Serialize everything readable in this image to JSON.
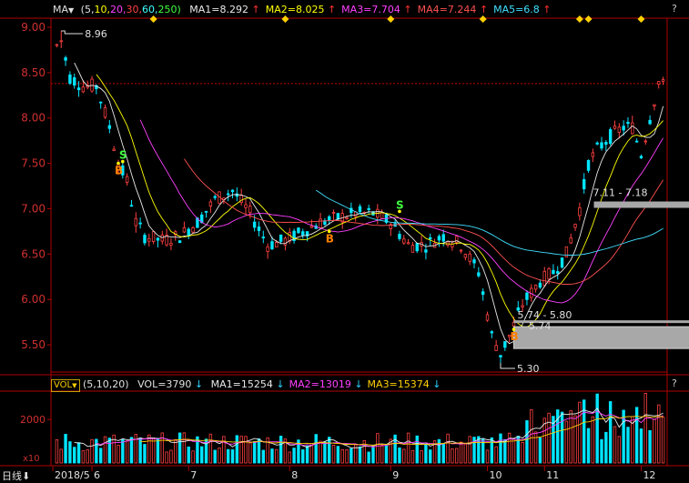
{
  "main_legend": {
    "indicator": "MA",
    "params": "(5,10,20,30,60,250)",
    "params_parts": [
      {
        "text": "(5,",
        "color": "#e0e0e0"
      },
      {
        "text": "10,",
        "color": "#ffff00"
      },
      {
        "text": "20,",
        "color": "#ff40ff"
      },
      {
        "text": "30,",
        "color": "#ff4040"
      },
      {
        "text": "60,",
        "color": "#40ffff"
      },
      {
        "text": "250)",
        "color": "#40ff40"
      }
    ],
    "items": [
      {
        "label": "MA1=8.292",
        "arrow": "↑",
        "color": "#e8e8e8"
      },
      {
        "label": "MA2=8.025",
        "arrow": "↑",
        "color": "#ffff00"
      },
      {
        "label": "MA3=7.704",
        "arrow": "↑",
        "color": "#ff40ff"
      },
      {
        "label": "MA4=7.244",
        "arrow": "↑",
        "color": "#ff5050"
      },
      {
        "label": "MA5=6.8",
        "arrow": "↑",
        "color": "#40e0ff"
      }
    ]
  },
  "vol_legend": {
    "indicator": "VOL",
    "params": "(5,10,20)",
    "vol_label": "VOL=3790",
    "vol_arrow": "↓",
    "items": [
      {
        "label": "MA1=15254",
        "arrow": "↓",
        "color": "#e8e8e8"
      },
      {
        "label": "MA2=13019",
        "arrow": "↓",
        "color": "#ff40ff"
      },
      {
        "label": "MA3=15374",
        "arrow": "↓",
        "color": "#ffd000"
      }
    ]
  },
  "help_icon": "?",
  "vol_scale_label": "x10",
  "period_label": "日线",
  "colors": {
    "up": "#ff4040",
    "down": "#00e5ff",
    "axis": "#b00000",
    "grid": "#b00000",
    "axis_text_price": "#d03030",
    "axis_text_time": "#e0e0e0"
  },
  "chart_data": [
    {
      "type": "candlestick",
      "ylim": [
        5.2,
        9.1
      ],
      "yticks": [
        "9.00",
        "8.50",
        "8.00",
        "7.50",
        "7.00",
        "6.50",
        "6.00",
        "5.50"
      ],
      "ytick_values": [
        9.0,
        8.5,
        8.0,
        7.5,
        7.0,
        6.5,
        6.0,
        5.5
      ],
      "xticks": [
        "2018/5",
        "6",
        "7",
        "8",
        "9",
        "10",
        "11",
        "12"
      ],
      "x_tick_index": [
        0,
        8,
        30,
        53,
        76,
        98,
        111,
        133
      ],
      "n_bars": 139,
      "annotations": [
        {
          "text": "8.96",
          "index": 1,
          "price": 8.96,
          "kind": "high"
        },
        {
          "text": "5.30",
          "index": 101,
          "price": 5.3,
          "kind": "low"
        },
        {
          "text": "7.11 - 7.18",
          "kind": "zone",
          "price_low": 7.11,
          "price_high": 7.18
        },
        {
          "text": "5.74 - 5.80",
          "kind": "zone",
          "price_low": 5.74,
          "price_high": 5.8
        },
        {
          "text": "5.74",
          "kind": "level",
          "price": 5.74
        }
      ],
      "signals": [
        {
          "text": "S",
          "index": 15,
          "price": 7.55,
          "color": "#40ff40"
        },
        {
          "text": "B",
          "index": 14,
          "price": 7.38,
          "color": "#ff8000"
        },
        {
          "text": "B",
          "index": 62,
          "price": 6.63,
          "color": "#ff8000"
        },
        {
          "text": "S",
          "index": 78,
          "price": 7.0,
          "color": "#40ff40"
        },
        {
          "text": "B",
          "index": 104,
          "price": 5.55,
          "color": "#ff8000"
        }
      ],
      "event_markers_index": [
        22,
        52,
        76,
        97,
        119,
        121,
        133
      ]
    },
    {
      "type": "bar",
      "ylabel": "",
      "yticks": [
        "2000"
      ],
      "ytick_values": [
        2000
      ],
      "ylim": [
        0,
        3300
      ]
    }
  ]
}
